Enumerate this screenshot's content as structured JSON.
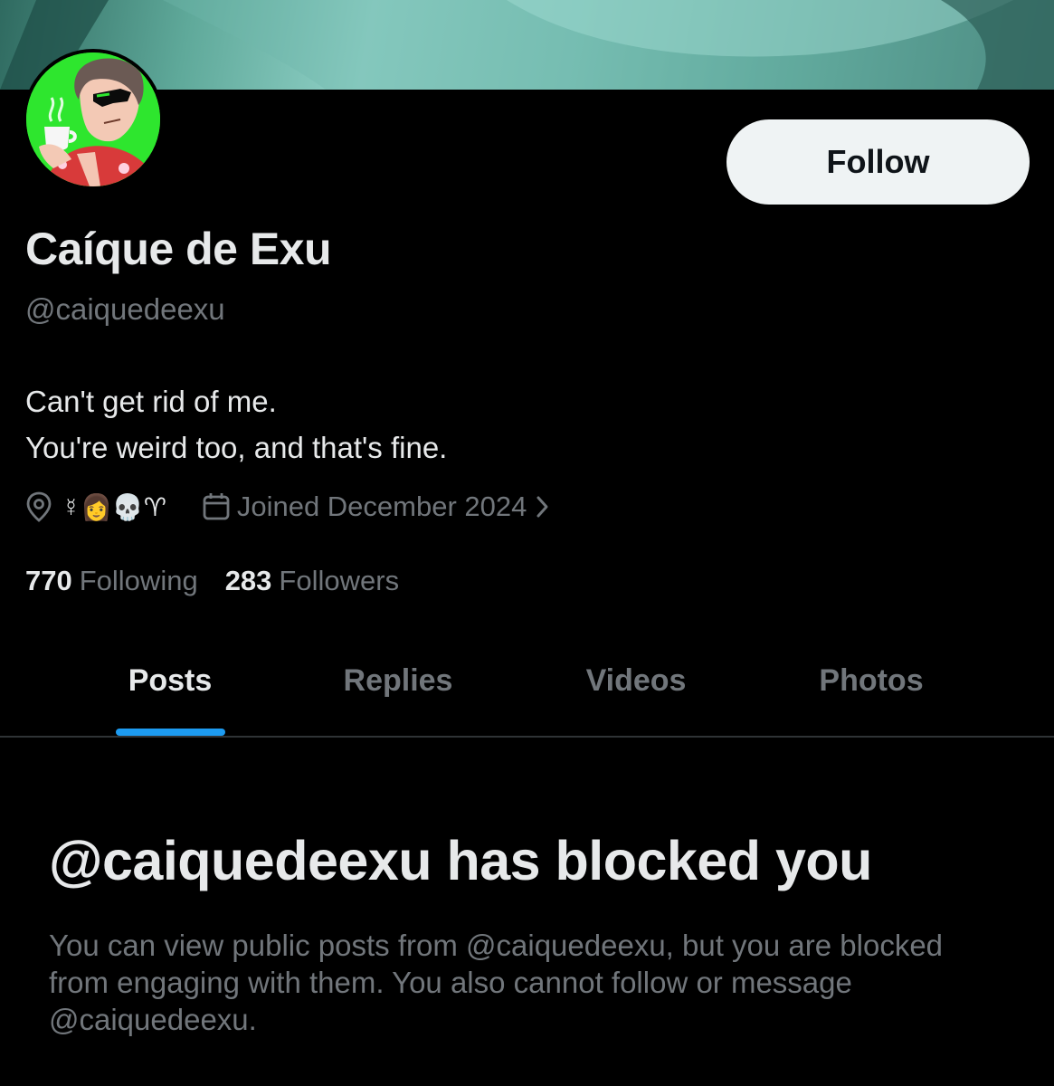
{
  "profile": {
    "display_name": "Caíque de Exu",
    "handle": "@caiquedeexu",
    "bio": [
      "Can't get rid of me.",
      "You're weird too, and that's fine."
    ],
    "location": "☿👩💀♈",
    "joined": "Joined December 2024",
    "following_count": "770",
    "following_label": "Following",
    "followers_count": "283",
    "followers_label": "Followers",
    "follow_label": "Follow"
  },
  "tabs": [
    {
      "label": "Posts",
      "active": true
    },
    {
      "label": "Replies",
      "active": false
    },
    {
      "label": "Videos",
      "active": false
    },
    {
      "label": "Photos",
      "active": false
    }
  ],
  "blocked": {
    "title": "@caiquedeexu has blocked you",
    "description": "You can view public posts from @caiquedeexu, but you are blocked from engaging with them. You also cannot follow or message @caiquedeexu."
  },
  "icons": {
    "location": "location-pin-icon",
    "calendar": "calendar-icon",
    "chevron": "chevron-right-icon"
  },
  "colors": {
    "background": "#000000",
    "text_primary": "#e7e9ea",
    "text_secondary": "#71767b",
    "accent": "#1d9bf0",
    "avatar_bg": "#2ee62e",
    "follow_bg": "#eff3f4"
  }
}
